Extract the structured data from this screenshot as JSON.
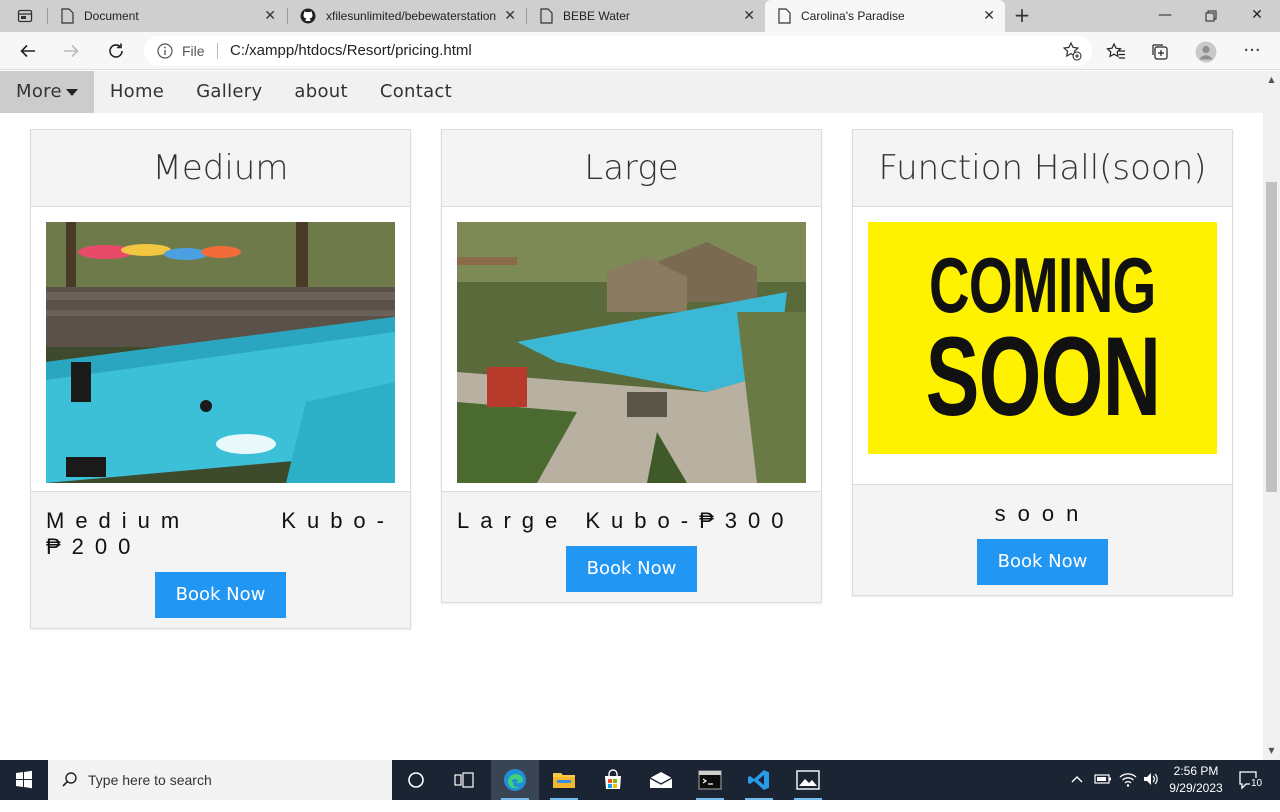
{
  "browser": {
    "tabs": [
      {
        "title": "Document"
      },
      {
        "title": "xfilesunlimited/bebewaterstation"
      },
      {
        "title": "BEBE Water"
      },
      {
        "title": "Carolina's Paradise"
      }
    ],
    "address": {
      "scheme_label": "File",
      "url": "C:/xampp/htdocs/Resort/pricing.html"
    }
  },
  "navbar": {
    "items": [
      {
        "label": "More"
      },
      {
        "label": "Home"
      },
      {
        "label": "Gallery"
      },
      {
        "label": "about"
      },
      {
        "label": "Contact"
      }
    ]
  },
  "cards": [
    {
      "title": "Medium",
      "price": "Medium Kubo-₱200",
      "button": "Book Now"
    },
    {
      "title": "Large",
      "price": "Large Kubo-₱300",
      "button": "Book Now"
    },
    {
      "title": "Function Hall(soon)",
      "price": "soon",
      "button": "Book Now",
      "image_text": [
        "COMING",
        "SOON"
      ]
    }
  ],
  "taskbar": {
    "search_placeholder": "Type here to search",
    "time": "2:56 PM",
    "date": "9/29/2023",
    "notifications": "10"
  },
  "colors": {
    "accent": "#2196F3",
    "coming_soon_bg": "#FFF200"
  }
}
